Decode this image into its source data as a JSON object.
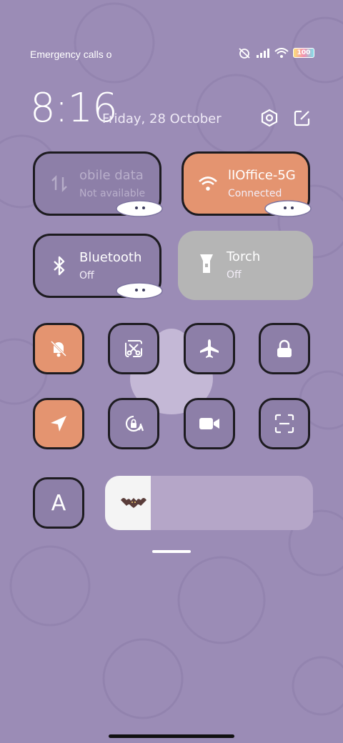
{
  "status_bar": {
    "carrier": "Emergency calls o",
    "battery": "100"
  },
  "header": {
    "time": "8:16",
    "date": "Friday, 28 October",
    "settings_icon": "settings-hex-icon",
    "edit_icon": "edit-icon"
  },
  "tiles": {
    "mobile_data": {
      "title": "obile data",
      "subtitle": "Not available",
      "state": "disabled",
      "icon": "mobile-data-icon"
    },
    "wifi": {
      "title": "lIOffice-5G",
      "subtitle": "Connected",
      "state": "on",
      "icon": "wifi-icon"
    },
    "bluetooth": {
      "title": "Bluetooth",
      "subtitle": "Off",
      "state": "off",
      "icon": "bluetooth-icon"
    },
    "torch": {
      "title": "Torch",
      "subtitle": "Off",
      "state": "off",
      "icon": "torch-icon"
    }
  },
  "toggles_row1": [
    {
      "name": "silent",
      "icon": "bell-off-icon",
      "on": true
    },
    {
      "name": "screenshot",
      "icon": "scissors-icon",
      "on": false
    },
    {
      "name": "airplane",
      "icon": "airplane-icon",
      "on": false
    },
    {
      "name": "lock",
      "icon": "lock-icon",
      "on": false
    }
  ],
  "toggles_row2": [
    {
      "name": "location",
      "icon": "location-arrow-icon",
      "on": true
    },
    {
      "name": "rotation",
      "icon": "rotation-lock-icon",
      "on": false
    },
    {
      "name": "screen-record",
      "icon": "video-camera-icon",
      "on": false
    },
    {
      "name": "scanner",
      "icon": "scan-icon",
      "on": false
    }
  ],
  "auto_brightness": {
    "label": "A"
  },
  "brightness": {
    "level": 0.22,
    "thumb_icon": "bat-icon"
  },
  "colors": {
    "accent": "#e49470",
    "background": "#9b8cb6",
    "tile_off": "#8d7fa8",
    "torch_tile": "#b5b5b5"
  }
}
